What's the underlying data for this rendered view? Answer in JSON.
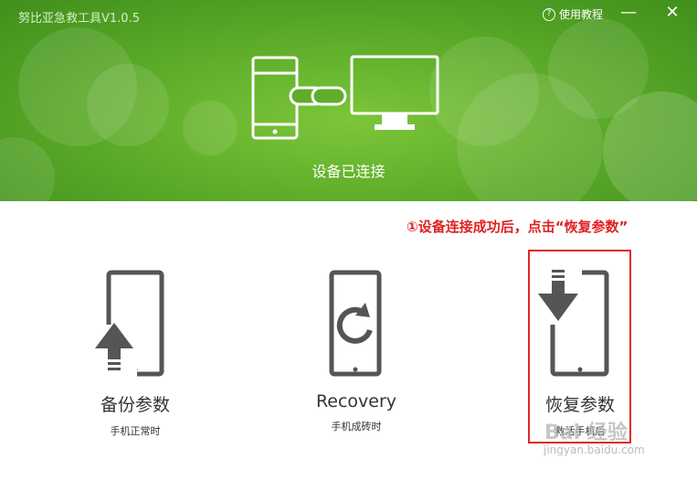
{
  "window": {
    "title": "努比亚急救工具V1.0.5",
    "help_label": "使用教程",
    "minimize_label": "—",
    "close_label": "✕"
  },
  "header": {
    "status": "设备已连接"
  },
  "annotation": "①设备连接成功后，点击“恢复参数”",
  "options": [
    {
      "title": "备份参数",
      "subtitle": "手机正常时",
      "icon": "phone-upload-icon"
    },
    {
      "title": "Recovery",
      "subtitle": "手机成砖时",
      "icon": "phone-refresh-icon"
    },
    {
      "title": "恢复参数",
      "subtitle": "救活手机后",
      "icon": "phone-download-icon"
    }
  ],
  "watermark": {
    "text": "Bai 经验",
    "url": "jingyan.baidu.com"
  },
  "colors": {
    "header_green": "#5fad2a",
    "icon_gray": "#555555",
    "annotation_red": "#e02020"
  }
}
